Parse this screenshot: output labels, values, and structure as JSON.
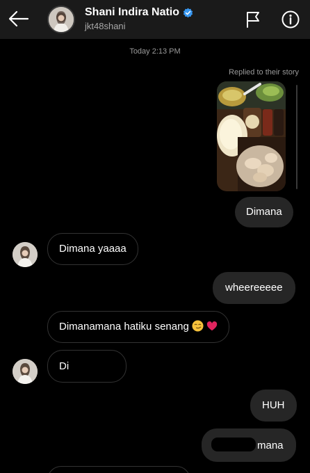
{
  "header": {
    "title": "Shani Indira Natio",
    "username": "jkt48shani"
  },
  "thread": {
    "timestamp": "Today 2:13 PM",
    "reply_note": "Replied to their story",
    "messages": [
      {
        "direction": "out",
        "text": "Dimana"
      },
      {
        "direction": "in",
        "text": "Dimana yaaaa"
      },
      {
        "direction": "out",
        "text": "wheereeeee"
      },
      {
        "direction": "in",
        "text": "Dimanamana hatiku senang"
      },
      {
        "direction": "in",
        "text": "Di"
      },
      {
        "direction": "out",
        "text": "HUH"
      },
      {
        "direction": "out",
        "text": "mana"
      }
    ]
  },
  "icons": {
    "back": "arrow-left-icon",
    "verified": "verified-badge-icon",
    "flag": "flag-icon",
    "info": "info-icon",
    "emoji_1": "smirking-face-emoji",
    "emoji_2": "red-heart-emoji"
  },
  "colors": {
    "background": "#000000",
    "header": "#1a1a1a",
    "outgoing_bubble": "#262626",
    "verified": "#3897f0",
    "heart": "#e0245e"
  }
}
